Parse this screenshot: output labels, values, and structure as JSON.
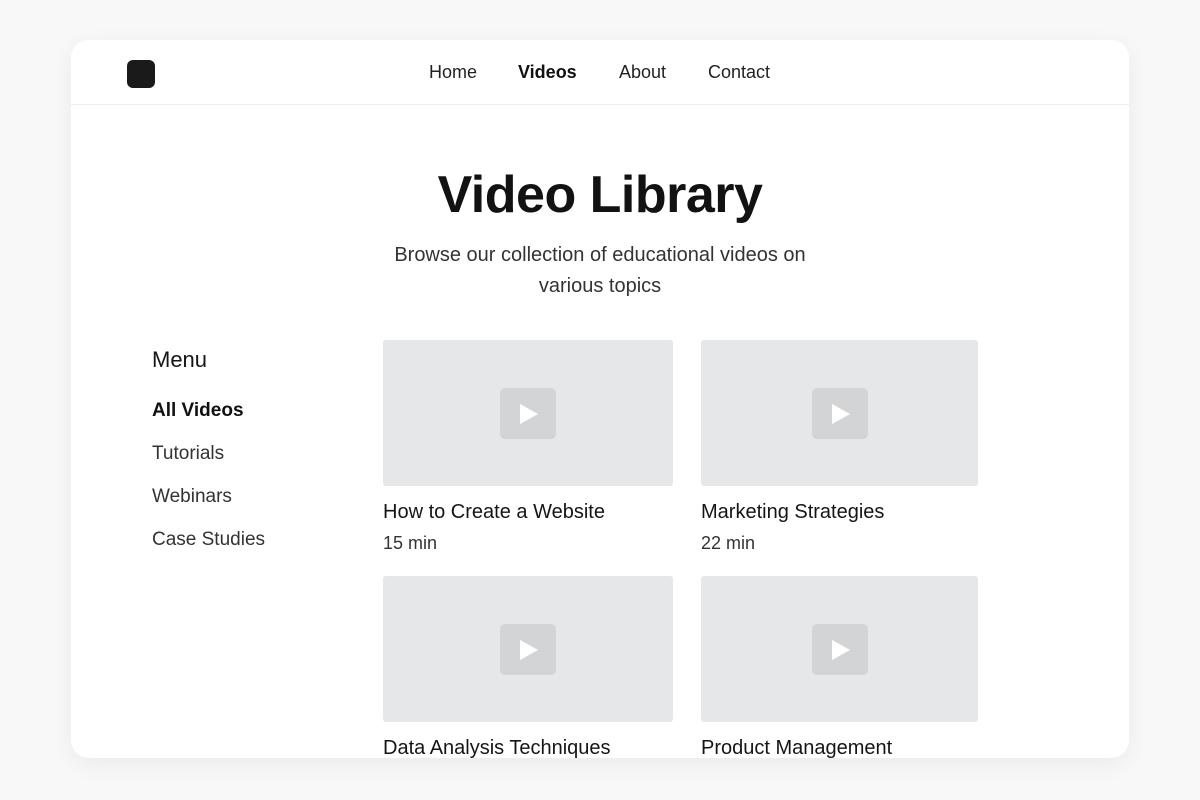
{
  "header": {
    "nav": [
      {
        "label": "Home",
        "active": false
      },
      {
        "label": "Videos",
        "active": true
      },
      {
        "label": "About",
        "active": false
      },
      {
        "label": "Contact",
        "active": false
      }
    ]
  },
  "hero": {
    "title": "Video Library",
    "subtitle": "Browse our collection of educational videos on various topics"
  },
  "sidebar": {
    "title": "Menu",
    "items": [
      {
        "label": "All Videos",
        "active": true
      },
      {
        "label": "Tutorials",
        "active": false
      },
      {
        "label": "Webinars",
        "active": false
      },
      {
        "label": "Case Studies",
        "active": false
      }
    ]
  },
  "videos": [
    {
      "title": "How to Create a Website",
      "duration": "15 min"
    },
    {
      "title": "Marketing Strategies",
      "duration": "22 min"
    },
    {
      "title": "Data Analysis Techniques",
      "duration": ""
    },
    {
      "title": "Product Management",
      "duration": ""
    }
  ],
  "icons": {
    "logo": "app-logo",
    "play": "play-icon"
  },
  "colors": {
    "background": "#f8f8f8",
    "card_bg": "#ffffff",
    "thumbnail": "#e6e7e9",
    "play_button": "#d3d4d6",
    "text_primary": "#111111"
  }
}
